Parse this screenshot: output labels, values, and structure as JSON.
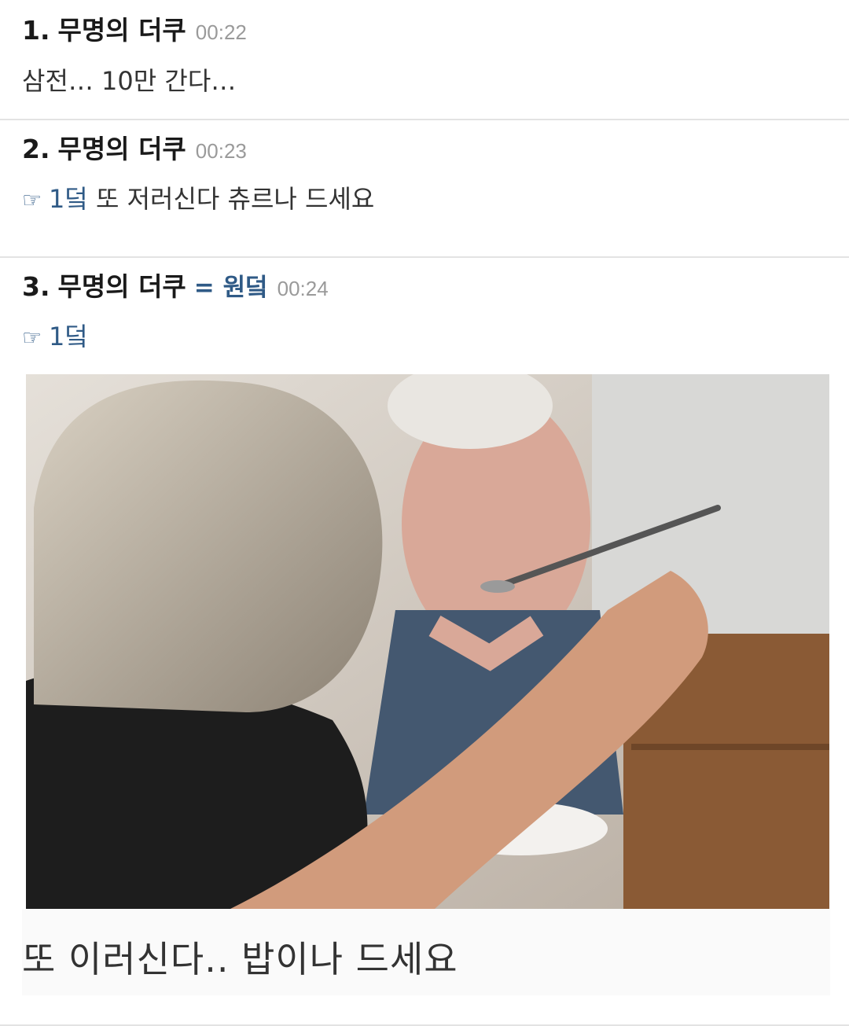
{
  "comments": [
    {
      "number": "1.",
      "nickname": "무명의 더쿠",
      "time": "00:22",
      "text": "삼전… 10만 간다…"
    },
    {
      "number": "2.",
      "nickname": "무명의 더쿠",
      "time": "00:23",
      "reply_to": "1덬",
      "text": " 또 저러신다 츄르나 드세요"
    },
    {
      "number": "3.",
      "nickname": "무명의 더쿠",
      "author_badge": "= 원덬",
      "time": "00:24",
      "reply_to": "1덬",
      "image_caption": "또 이러신다.. 밥이나 드세요"
    }
  ],
  "reply_icon": "pointing-hand-icon",
  "colors": {
    "link": "#2f5a86",
    "time": "#9a9a9a",
    "divider": "#e3e3e3"
  }
}
